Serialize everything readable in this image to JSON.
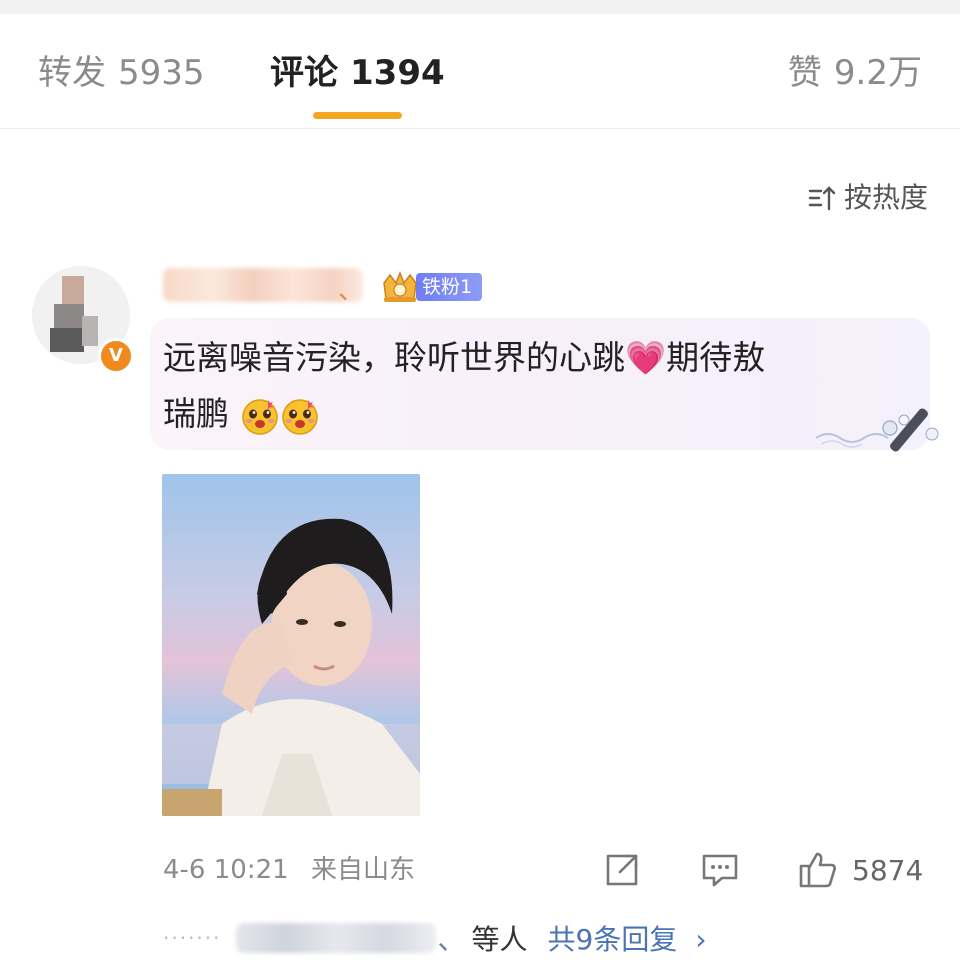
{
  "tabs": {
    "repost": {
      "label": "转发",
      "count": "5935"
    },
    "comment": {
      "label": "评论",
      "count": "1394"
    },
    "like": {
      "label": "赞",
      "count": "9.2万"
    }
  },
  "sort": {
    "label": "按热度",
    "icon": "sort-icon"
  },
  "comment": {
    "fan_badge": "铁粉1",
    "verified_badge": "V",
    "text_line1": "远离噪音污染，聆听世界的心跳",
    "heart_emoji": "💗",
    "text_line1_end": "期待敖",
    "text_line2": "瑞鹏",
    "time": "4-6 10:21",
    "source": "来自山东",
    "like_count": "5874"
  },
  "replies": {
    "dots": "·······",
    "sep": "、",
    "others": "等人",
    "link": "共9条回复",
    "chevron": "›"
  },
  "colors": {
    "accent": "#f5a623",
    "link": "#4a74b5",
    "verified": "#f08a1e",
    "fan_badge": "#7382f4"
  }
}
